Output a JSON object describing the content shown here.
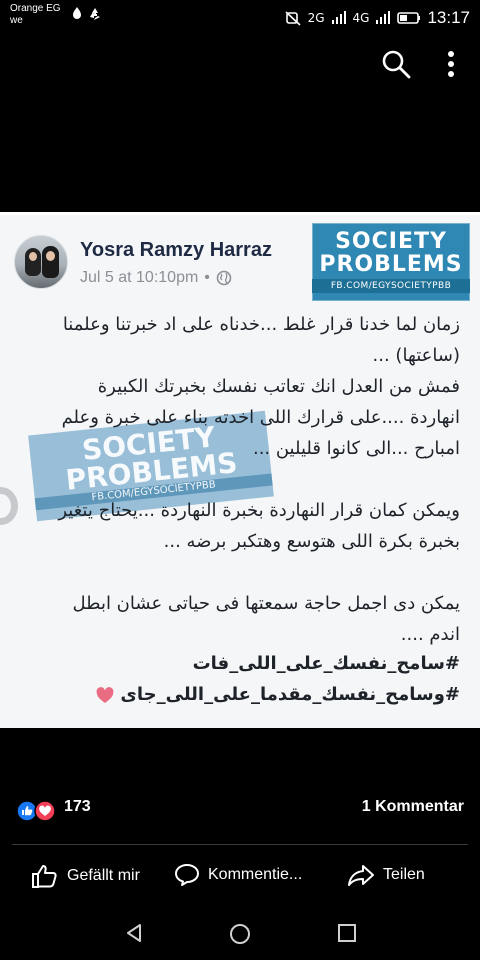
{
  "status_bar": {
    "carrier_line1": "Orange EG",
    "carrier_line2": "we",
    "network_label_1": "2G",
    "network_label_2": "4G",
    "time": "13:17",
    "icons": [
      "water-drop-icon",
      "recycle-icon",
      "mute-vibrate-icon",
      "signal-icon",
      "battery-icon"
    ]
  },
  "top_actions": {
    "search_icon": "search-icon",
    "more_icon": "more-vertical-icon"
  },
  "post_image": {
    "author_name": "Yosra Ramzy Harraz",
    "timestamp": "Jul 5 at 10:10pm",
    "meta_separator": "•",
    "privacy_icon": "globe-icon",
    "logo_top": {
      "line1": "SOCIETY",
      "line2": "PROBLEMS",
      "url": "FB.COM/EGYSOCIETYPBB"
    },
    "watermark": {
      "line1": "SOCIETY",
      "line2": "PROBLEMS",
      "url": "FB.COM/EGYSOCIETYPBB"
    },
    "body_text": "زمان لما خدنا قرار غلط ...خدناه على اد خبرتنا وعلمنا\n(ساعتها) ...\nفمش من العدل انك تعاتب نفسك بخبرتك الكبيرة\nانهاردة ....على قرارك اللى اخدته بناء على خبرة وعلم\nامبارح ...الى كانوا قليلين ...\n\nويمكن كمان قرار النهاردة بخبرة النهاردة ...يحتاج يتغير\nبخبرة بكرة اللى هتوسع وهتكبر برضه ...\n\nيمكن دى اجمل حاجة سمعتها فى حياتى عشان ابطل\nاندم ....",
    "hashtag_1": "#سامح_نفسك_على_اللى_فات",
    "hashtag_2": "#وسامح_نفسك_مقدما_على_اللى_جاى"
  },
  "reactions": {
    "count": "173",
    "comments": "1 Kommentar",
    "icons": [
      "like-reaction-icon",
      "love-reaction-icon"
    ]
  },
  "actions": {
    "like_label": "Gefällt mir",
    "comment_label": "Kommentie...",
    "share_label": "Teilen"
  },
  "navigation": {
    "back_icon": "back-triangle-icon",
    "home_icon": "home-circle-icon",
    "recent_icon": "recent-square-icon"
  },
  "colors": {
    "background": "#000000",
    "post_background": "#f5f6f8",
    "accent_blue": "#1877f2",
    "love_red": "#f33e58",
    "logo_blue": "#2f87b4"
  }
}
